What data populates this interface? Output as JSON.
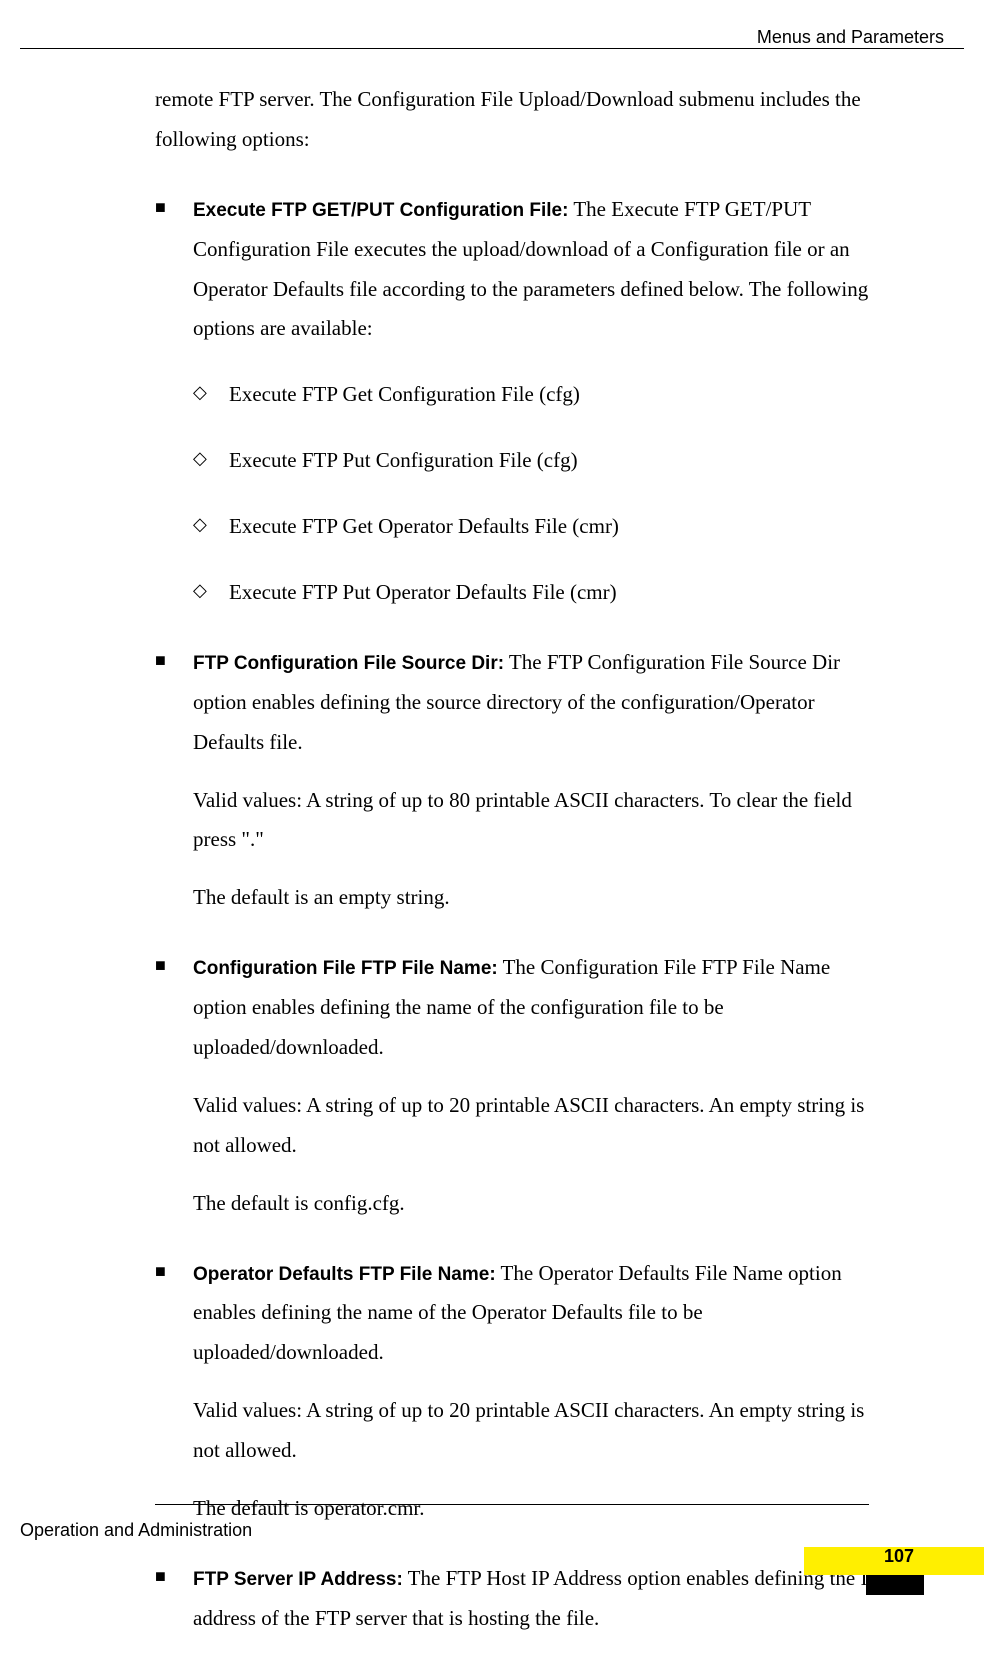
{
  "header": "Menus and Parameters",
  "intro": "remote FTP server. The Configuration File Upload/Download submenu includes the following options:",
  "bullets": [
    {
      "title": "Execute FTP GET/PUT Configuration File:",
      "text": " The Execute FTP GET/PUT Configuration File executes the upload/download of a Configuration file or an Operator Defaults file according to the parameters defined below. The following options are available:",
      "subs": [
        "Execute FTP Get Configuration File (cfg)",
        "Execute FTP Put Configuration File (cfg)",
        "Execute FTP Get Operator Defaults File (cmr)",
        "Execute FTP Put Operator Defaults File (cmr)"
      ]
    },
    {
      "title": "FTP Configuration File Source Dir:",
      "text": " The FTP Configuration File Source Dir option enables defining the source directory of the configuration/Operator Defaults file.",
      "p2": "Valid values: A string of up to 80 printable ASCII characters. To clear the field press \".\"",
      "p3": "The default is an empty string."
    },
    {
      "title": "Configuration File FTP File Name:",
      "text": " The Configuration File FTP File Name option enables defining the name of the configuration file to be uploaded/downloaded.",
      "p2": "Valid values: A string of up to 20 printable ASCII characters. An empty string is not allowed.",
      "p3": "The default is config.cfg."
    },
    {
      "title": "Operator Defaults FTP File Name:",
      "text": " The Operator Defaults File Name option enables defining the name of the Operator Defaults file to be uploaded/downloaded.",
      "p2": "Valid values: A string of up to 20 printable ASCII characters. An empty string is not allowed.",
      "p3": "The default is operator.cmr."
    },
    {
      "title": "FTP Server IP Address:",
      "text": " The FTP Host IP Address option enables defining the IP address of the FTP server that is hosting the file."
    }
  ],
  "footer": "Operation and Administration",
  "page": "107"
}
